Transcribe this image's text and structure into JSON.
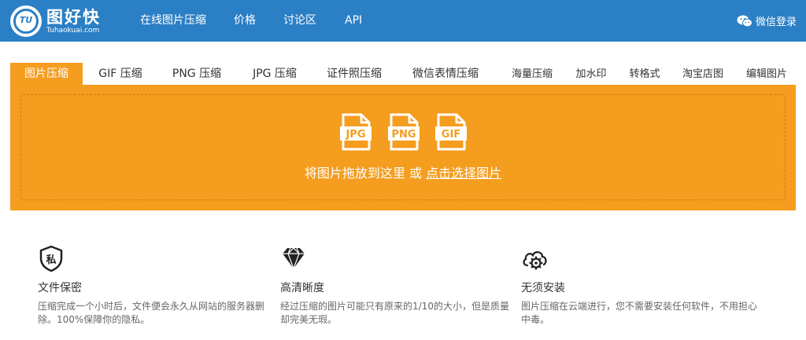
{
  "header": {
    "logo_cn": "图好快",
    "logo_en": "Tuhaokuai.com",
    "logo_badge": "TU",
    "nav": [
      {
        "label": "在线图片压缩"
      },
      {
        "label": "价格"
      },
      {
        "label": "讨论区"
      },
      {
        "label": "API"
      }
    ],
    "login_label": "微信登录"
  },
  "tabs": [
    {
      "label": "图片压缩",
      "active": true
    },
    {
      "label": "GIF 压缩"
    },
    {
      "label": "PNG 压缩"
    },
    {
      "label": "JPG 压缩"
    },
    {
      "label": "证件照压缩"
    },
    {
      "label": "微信表情压缩"
    },
    {
      "label": "海量压缩"
    },
    {
      "label": "加水印"
    },
    {
      "label": "转格式"
    },
    {
      "label": "淘宝店图"
    },
    {
      "label": "编辑图片"
    }
  ],
  "upload": {
    "file_types": [
      "JPG",
      "PNG",
      "GIF"
    ],
    "drop_text": "将图片拖放到这里 或 ",
    "choose_link": "点击选择图片"
  },
  "features": [
    {
      "icon": "shield-private-icon",
      "icon_char": "私",
      "title": "文件保密",
      "desc": "压缩完成一个小时后，文件便会永久从网站的服务器删除。100%保障你的隐私。"
    },
    {
      "icon": "diamond-icon",
      "title": "高清晰度",
      "desc": "经过压缩的图片可能只有原来的1/10的大小，但是质量却完美无瑕。"
    },
    {
      "icon": "cloud-gear-icon",
      "title": "无须安装",
      "desc": "图片压缩在云端进行，您不需要安装任何软件，不用担心中毒。"
    }
  ],
  "colors": {
    "header_bg": "#2b7fc4",
    "accent": "#f59d1e"
  }
}
